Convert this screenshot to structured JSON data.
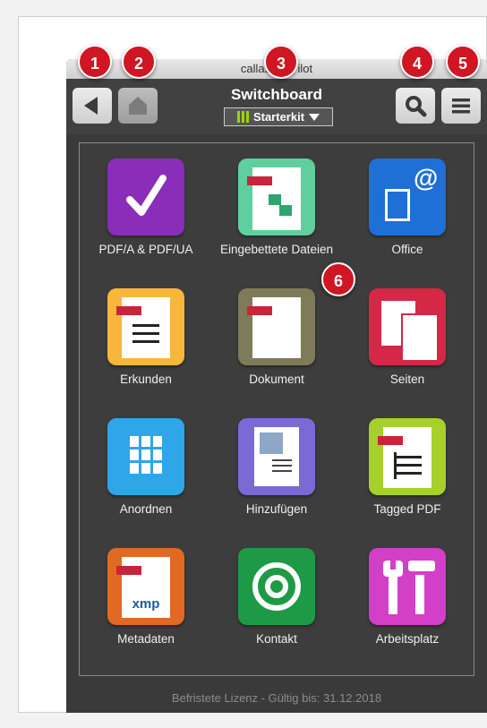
{
  "window": {
    "title": "callas pdfPilot",
    "footer": "Befristete Lizenz - Gültig bis: 31.12.2018"
  },
  "toolbar": {
    "back_icon": "back-triangle-icon",
    "home_icon": "home-icon",
    "title": "Switchboard",
    "profile_selected": "Starterkit",
    "search_icon": "search-icon",
    "menu_icon": "menu-icon"
  },
  "tiles": [
    {
      "label": "PDF/A & PDF/UA",
      "icon": "checkmark-icon",
      "color": "#8a2db8"
    },
    {
      "label": "Eingebettete Dateien",
      "icon": "embedded-files-icon",
      "color": "#5fcf9e"
    },
    {
      "label": "Office",
      "icon": "office-icon",
      "color": "#1e6fd6"
    },
    {
      "label": "Erkunden",
      "icon": "explore-list-icon",
      "color": "#f6b73c"
    },
    {
      "label": "Dokument",
      "icon": "document-icon",
      "color": "#7f7b58"
    },
    {
      "label": "Seiten",
      "icon": "pages-icon",
      "color": "#d42846"
    },
    {
      "label": "Anordnen",
      "icon": "arrange-grid-icon",
      "color": "#2fa6e8"
    },
    {
      "label": "Hinzufügen",
      "icon": "add-content-icon",
      "color": "#7b6ad6"
    },
    {
      "label": "Tagged PDF",
      "icon": "tagged-pdf-icon",
      "color": "#a5d12a"
    },
    {
      "label": "Metadaten",
      "icon": "xmp-metadata-icon",
      "color": "#e06a23",
      "xmp_text": "xmp"
    },
    {
      "label": "Kontakt",
      "icon": "contact-target-icon",
      "color": "#1e9a46"
    },
    {
      "label": "Arbeitsplatz",
      "icon": "workplace-tools-icon",
      "color": "#d33fc6"
    }
  ],
  "annotations": [
    "1",
    "2",
    "3",
    "4",
    "5",
    "6"
  ]
}
